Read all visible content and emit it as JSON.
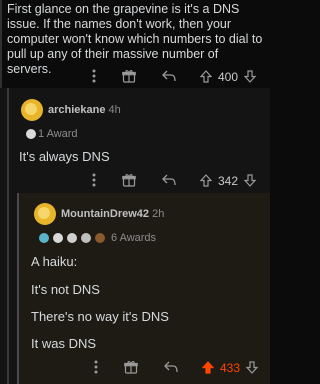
{
  "comment1": {
    "text": "First glance on the grapevine is it's a DNS issue. If the names don't work, then your computer won't know which numbers to dial to pull up any of their massive number of servers.",
    "score": "400"
  },
  "comment2": {
    "username": "archiekane",
    "time": "4h",
    "awards": "1 Award",
    "text": "It's always DNS",
    "score": "342"
  },
  "comment3": {
    "username": "MountainDrew42",
    "time": "2h",
    "awards": "6 Awards",
    "lines": [
      "A haiku:",
      "It's not DNS",
      "There's no way it's DNS",
      "It was DNS"
    ],
    "score": "433"
  },
  "colors": {
    "upvoted": "#ff4500",
    "avatar": "#e8b52a"
  }
}
